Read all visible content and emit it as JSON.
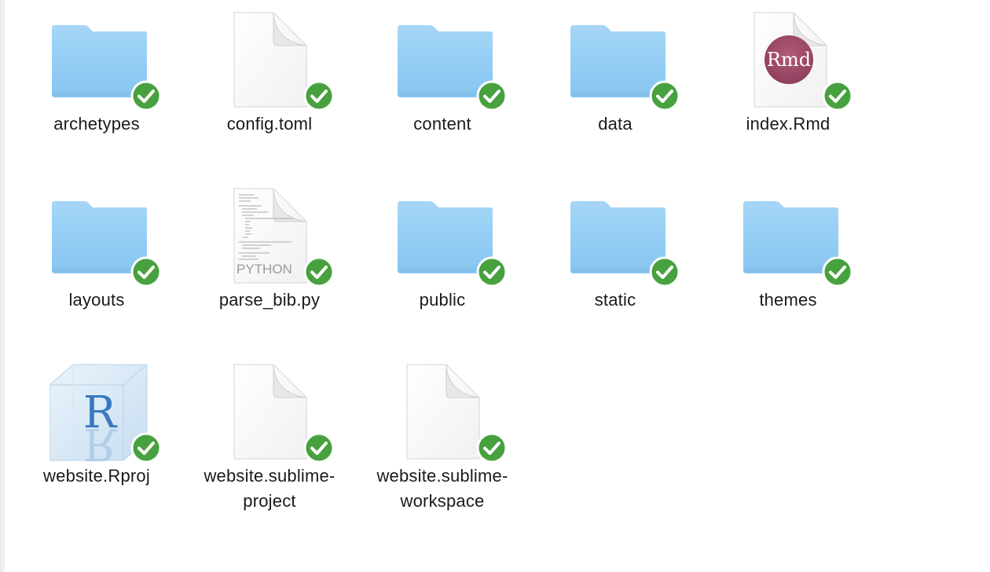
{
  "items": [
    {
      "name": "archetypes",
      "type": "folder"
    },
    {
      "name": "config.toml",
      "type": "blank-document"
    },
    {
      "name": "content",
      "type": "folder"
    },
    {
      "name": "data",
      "type": "folder"
    },
    {
      "name": "index.Rmd",
      "type": "rmd-document",
      "icon_text": "Rmd"
    },
    {
      "name": "layouts",
      "type": "folder"
    },
    {
      "name": "parse_bib.py",
      "type": "python-document",
      "icon_text": "PYTHON"
    },
    {
      "name": "public",
      "type": "folder"
    },
    {
      "name": "static",
      "type": "folder"
    },
    {
      "name": "themes",
      "type": "folder"
    },
    {
      "name": "website.Rproj",
      "type": "rproj-document",
      "icon_text": "R"
    },
    {
      "name_line1": "website.sublime-",
      "name_line2": "project",
      "type": "blank-document"
    },
    {
      "name_line1": "website.sublime-",
      "name_line2": "workspace",
      "type": "blank-document"
    }
  ],
  "sync_status": "synced",
  "colors": {
    "folder_blue": "#8ec9f2",
    "folder_tab": "#a9d8f6",
    "sync_green": "#47a13e",
    "rmd_badge": "#a24d6d"
  }
}
